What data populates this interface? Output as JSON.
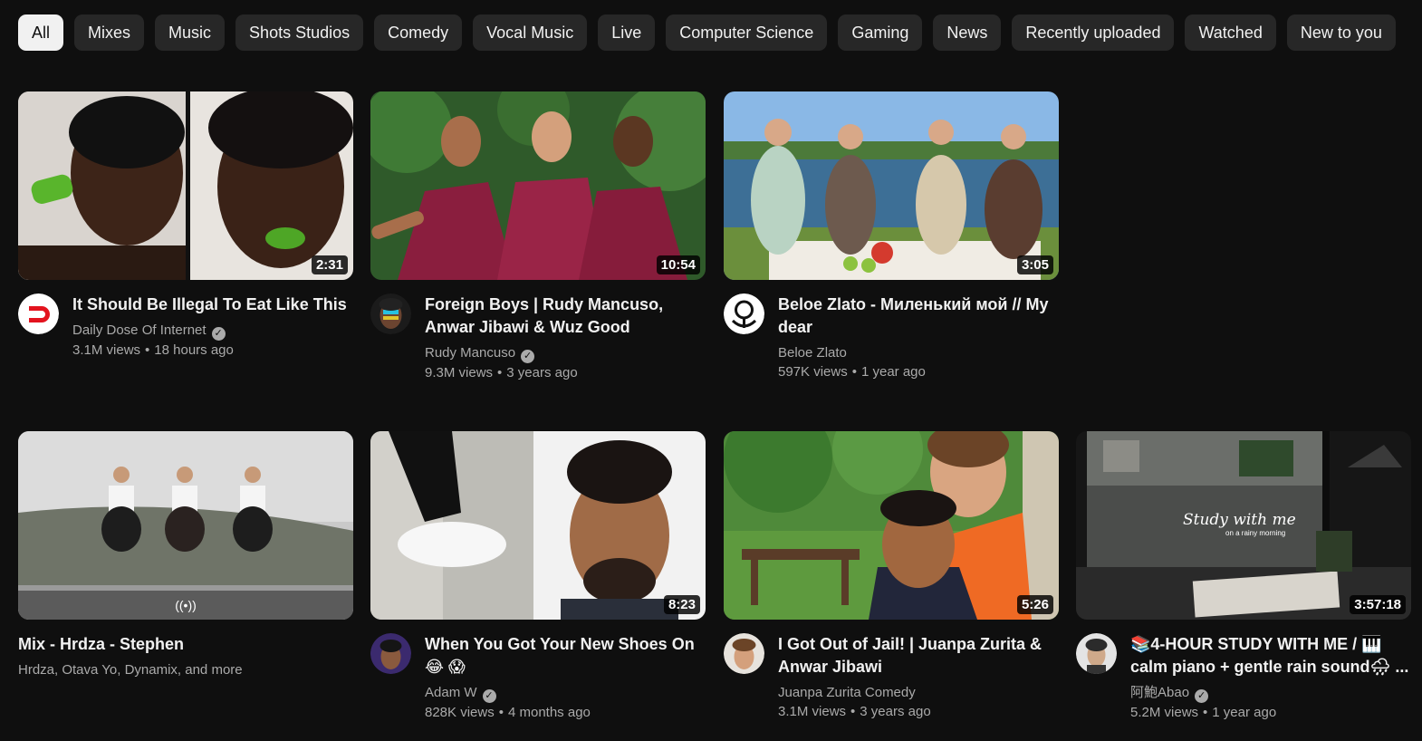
{
  "chips": [
    {
      "label": "All",
      "active": true
    },
    {
      "label": "Mixes"
    },
    {
      "label": "Music"
    },
    {
      "label": "Shots Studios"
    },
    {
      "label": "Comedy"
    },
    {
      "label": "Vocal Music"
    },
    {
      "label": "Live"
    },
    {
      "label": "Computer Science"
    },
    {
      "label": "Gaming"
    },
    {
      "label": "News"
    },
    {
      "label": "Recently uploaded"
    },
    {
      "label": "Watched"
    },
    {
      "label": "New to you"
    }
  ],
  "videos": [
    {
      "title": "It Should Be Illegal To Eat Like This",
      "channel": "Daily Dose Of Internet",
      "verified": true,
      "views": "3.1M views",
      "age": "18 hours ago",
      "duration": "2:31"
    },
    {
      "title": "Foreign Boys | Rudy Mancuso, Anwar Jibawi & Wuz Good",
      "channel": "Rudy Mancuso",
      "verified": true,
      "views": "9.3M views",
      "age": "3 years ago",
      "duration": "10:54"
    },
    {
      "title": "Beloe Zlato - Миленький мой // My dear",
      "channel": "Beloe Zlato",
      "verified": false,
      "views": "597K views",
      "age": "1 year ago",
      "duration": "3:05"
    },
    {
      "title": "Mix - Hrdza - Stephen",
      "channel": "Hrdza, Otava Yo, Dynamix, and more",
      "mix_icon": "((•))"
    },
    {
      "title": "When You Got Your New Shoes On 😂 😱",
      "channel": "Adam W",
      "verified": true,
      "views": "828K views",
      "age": "4 months ago",
      "duration": "8:23"
    },
    {
      "title": "I Got Out of Jail! | Juanpa Zurita & Anwar Jibawi",
      "channel": "Juanpa Zurita Comedy",
      "verified": false,
      "views": "3.1M views",
      "age": "3 years ago",
      "duration": "5:26"
    },
    {
      "title": "📚4-HOUR STUDY WITH ME / 🎹 calm piano + gentle rain sound🌧 ...",
      "channel": "阿鮑Abao",
      "verified": true,
      "views": "5.2M views",
      "age": "1 year ago",
      "duration": "3:57:18"
    }
  ],
  "thumbnail_overlays": {
    "study_text": "Study with me",
    "study_sub": "on a rainy morning"
  },
  "verified_glyph": "✓",
  "dot": "•",
  "colors": {
    "background": "#0f0f0f",
    "chip": "#272727",
    "chip_active": "#f1f1f1",
    "secondary_text": "#aaaaaa"
  }
}
